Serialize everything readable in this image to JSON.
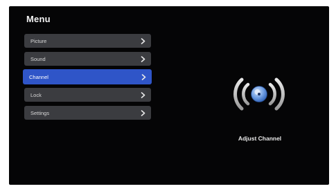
{
  "menu": {
    "title": "Menu",
    "items": [
      {
        "label": "Picture",
        "selected": false
      },
      {
        "label": "Sound",
        "selected": false
      },
      {
        "label": "Channel",
        "selected": true
      },
      {
        "label": "Lock",
        "selected": false
      },
      {
        "label": "Settings",
        "selected": false
      }
    ]
  },
  "preview": {
    "icon": "broadcast-disc-icon",
    "label": "Adjust Channel"
  },
  "colors": {
    "background": "#050506",
    "item_bg": "#3b3c40",
    "selected_bg": "#2f55c8",
    "icon_accent": "#4a7fd6"
  }
}
